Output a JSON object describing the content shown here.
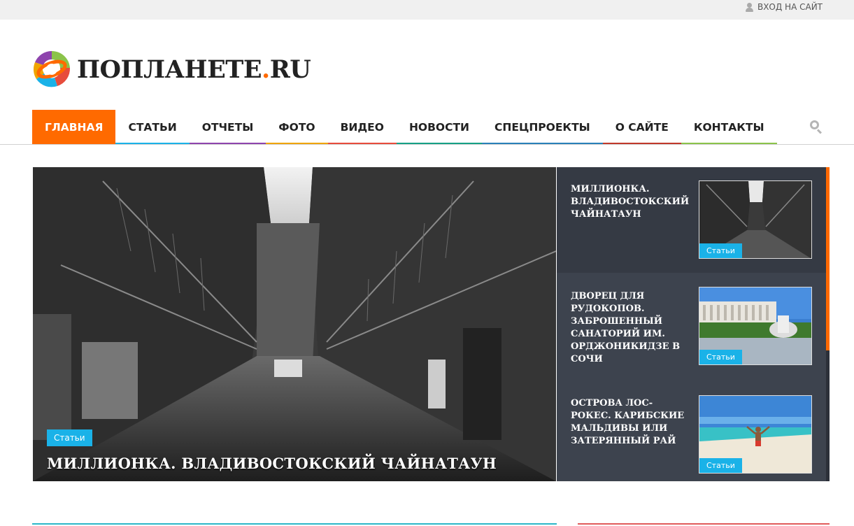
{
  "topbar": {
    "login_label": "ВХОД НА САЙТ",
    "login_icon": "user-icon"
  },
  "logo": {
    "name": "ПОПЛАНЕТЕ",
    "dot": ".",
    "tld": "RU"
  },
  "nav": {
    "items": [
      {
        "label": "ГЛАВНАЯ",
        "color": "#ff6a00"
      },
      {
        "label": "СТАТЬИ",
        "color": "#1ab2e8"
      },
      {
        "label": "ОТЧЕТЫ",
        "color": "#8e44ad"
      },
      {
        "label": "ФОТО",
        "color": "#f0a500"
      },
      {
        "label": "ВИДЕО",
        "color": "#e74c3c"
      },
      {
        "label": "НОВОСТИ",
        "color": "#16a085"
      },
      {
        "label": "СПЕЦПРОЕКТЫ",
        "color": "#2980b9"
      },
      {
        "label": "О САЙТЕ",
        "color": "#c0392b"
      },
      {
        "label": "КОНТАКТЫ",
        "color": "#8bc34a"
      }
    ],
    "search_icon": "search-icon"
  },
  "hero": {
    "category": "Статьи",
    "title": "МИЛЛИОНКА. ВЛАДИВОСТОКСКИЙ ЧАЙНАТАУН"
  },
  "side": {
    "items": [
      {
        "title": "МИЛЛИОНКА. ВЛАДИВОСТОКСКИЙ ЧАЙНАТАУН",
        "category": "Статьи"
      },
      {
        "title": "ДВОРЕЦ ДЛЯ РУДОКОПОВ. ЗАБРОШЕННЫЙ САНАТОРИЙ ИМ. ОРДЖОНИКИДЗЕ В СОЧИ",
        "category": "Статьи"
      },
      {
        "title": "ОСТРОВА ЛОС-РОКЕС. КАРИБСКИЕ МАЛЬДИВЫ ИЛИ ЗАТЕРЯННЫЙ РАЙ",
        "category": "Статьи"
      }
    ]
  },
  "colors": {
    "accent": "#ff6a00",
    "badge": "#1ab2e8",
    "sidebar": "#3d434e"
  }
}
